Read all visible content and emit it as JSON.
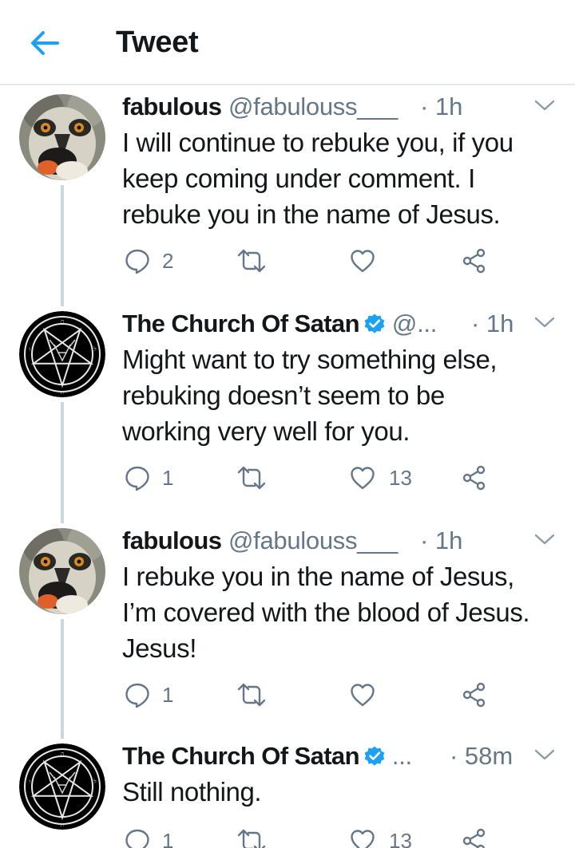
{
  "header": {
    "back_icon": "arrow-left-icon",
    "title": "Tweet",
    "accent": "#1da1f2"
  },
  "tweets": [
    {
      "avatar": "lemur-avatar",
      "name": "fabulous",
      "handle": "@fabulouss___",
      "time": "· 1h",
      "verified": false,
      "lines": [
        "I will continue to rebuke you, if you",
        "keep coming under comment. I",
        "rebuke you in the name of Jesus."
      ],
      "replies": "2",
      "retweets": "",
      "likes": ""
    },
    {
      "avatar": "pentagram-avatar",
      "name": "The Church Of Satan",
      "handle": "@...",
      "time": "· 1h",
      "verified": true,
      "lines": [
        "Might want to try something else,",
        "rebuking doesn’t seem to be",
        "working very well for you."
      ],
      "replies": "1",
      "retweets": "",
      "likes": "13"
    },
    {
      "avatar": "lemur-avatar",
      "name": "fabulous",
      "handle": "@fabulouss___",
      "time": "· 1h",
      "verified": false,
      "lines": [
        "I rebuke you in the name of Jesus,",
        "I’m covered with the blood of Jesus.",
        "Jesus!"
      ],
      "replies": "1",
      "retweets": "",
      "likes": ""
    },
    {
      "avatar": "pentagram-avatar",
      "name": "The Church Of Satan",
      "handle": "...",
      "time": "· 58m",
      "verified": true,
      "lines": [
        "Still nothing."
      ],
      "replies": "1",
      "retweets": "",
      "likes": "13"
    }
  ],
  "colors": {
    "text": "#14171a",
    "secondary": "#657786",
    "icon": "#657786",
    "thread_line": "#ccd6dd",
    "verified": "#1da1f2"
  }
}
